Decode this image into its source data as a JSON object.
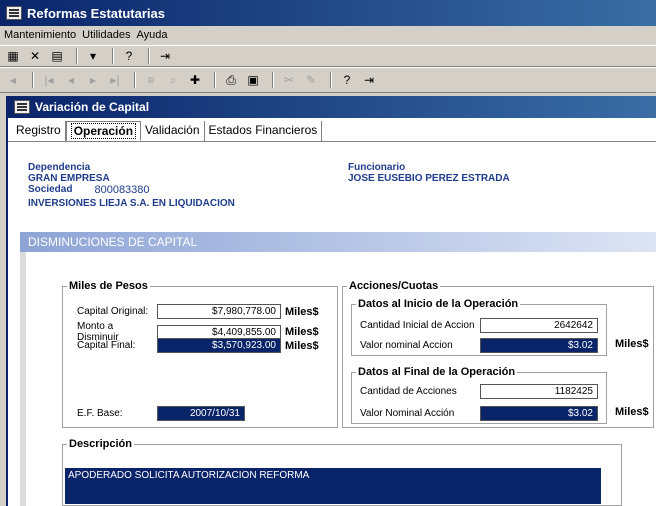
{
  "window": {
    "title": "Reformas Estatutarias"
  },
  "menu": {
    "items": [
      "Mantenimiento",
      "Utilidades",
      "Ayuda"
    ]
  },
  "child": {
    "title": "Variación de Capital"
  },
  "tabs": [
    {
      "label": "Registro"
    },
    {
      "label": "Operación"
    },
    {
      "label": "Validación"
    },
    {
      "label": "Estados Financieros"
    }
  ],
  "header": {
    "dependencia_label": "Dependencia",
    "dependencia_value": "GRAN EMPRESA",
    "sociedad_label": "Sociedad",
    "sociedad_value": "800083380",
    "company_name": "INVERSIONES LIEJA S.A. EN LIQUIDACION",
    "funcionario_label": "Funcionario",
    "funcionario_value": "JOSE EUSEBIO PEREZ ESTRADA"
  },
  "section": {
    "title": "DISMINUCIONES DE CAPITAL"
  },
  "miles": {
    "legend": "Miles de Pesos",
    "capital_original_label": "Capital Original:",
    "capital_original_value": "$7,980,778.00",
    "monto_label": "Monto a Disminuir",
    "monto_value": "$4,409,855.00",
    "capital_final_label": "Capital Final:",
    "capital_final_value": "$3,570,923.00",
    "unit": "Miles$",
    "ef_base_label": "E.F. Base:",
    "ef_base_value": "2007/10/31"
  },
  "acciones": {
    "legend": "Acciones/Cuotas",
    "inicio_legend": "Datos al Inicio de la Operación",
    "cant_inicial_label": "Cantidad Inicial de Accion",
    "cant_inicial_value": "2642642",
    "valor_nominal_label": "Valor nominal  Accion",
    "valor_nominal_value": "$3.02",
    "final_legend": "Datos al Final de la Operación",
    "cant_acciones_label": "Cantidad de Acciones",
    "cant_acciones_value": "1182425",
    "valor_nominal_final_label": "Valor Nominal Acción",
    "valor_nominal_final_value": "$3.02",
    "unit": "Miles$"
  },
  "descripcion": {
    "legend": "Descripción",
    "text": "APODERADO SOLICITA AUTORIZACION REFORMA"
  }
}
